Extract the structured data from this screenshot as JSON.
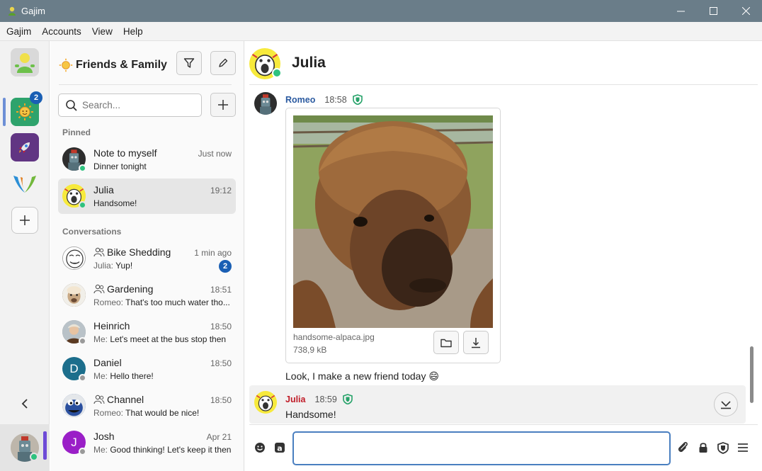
{
  "window": {
    "title": "Gajim"
  },
  "menu": [
    "Gajim",
    "Accounts",
    "View",
    "Help"
  ],
  "rail": {
    "badge": "2"
  },
  "sidebar": {
    "workspace_title": "Friends & Family",
    "search_placeholder": "Search...",
    "pinned_label": "Pinned",
    "conversations_label": "Conversations",
    "pinned": [
      {
        "name": "Note to myself",
        "time": "Just now",
        "who": "",
        "preview": "Dinner tonight",
        "group": false,
        "presence": "#2ec27e"
      },
      {
        "name": "Julia",
        "time": "19:12",
        "who": "",
        "preview": "Handsome!",
        "group": false,
        "presence": "#2ec27e"
      }
    ],
    "conversations": [
      {
        "name": "Bike Shedding",
        "time": "1 min ago",
        "who": "Julia: ",
        "preview": "Yup!",
        "group": true,
        "badge": "2"
      },
      {
        "name": "Gardening",
        "time": "18:51",
        "who": "Romeo: ",
        "preview": "That's too much water tho...",
        "group": true
      },
      {
        "name": "Heinrich",
        "time": "18:50",
        "who": "Me: ",
        "preview": "Let's meet at the bus stop then",
        "group": false,
        "presence": "#9a9a9a"
      },
      {
        "name": "Daniel",
        "time": "18:50",
        "who": "Me: ",
        "preview": "Hello there!",
        "group": false,
        "presence": "#9a9a9a",
        "initial": "D",
        "color": "#1c6e8c"
      },
      {
        "name": "Channel",
        "time": "18:50",
        "who": "Romeo: ",
        "preview": "That would be nice!",
        "group": true
      },
      {
        "name": "Josh",
        "time": "Apr 21",
        "who": "Me: ",
        "preview": "Good thinking! Let's keep it then",
        "group": false,
        "presence": "#9a9a9a",
        "initial": "J",
        "color": "#9a1fc7"
      }
    ]
  },
  "chat": {
    "contact_name": "Julia",
    "messages": [
      {
        "sender": "Romeo",
        "sender_color": "#2b5aa0",
        "time": "18:58",
        "file_name": "handsome-alpaca.jpg",
        "file_size": "738,9 kB",
        "text": "Look, I make a new friend today 😄"
      },
      {
        "sender": "Julia",
        "sender_color": "#c01c28",
        "time": "18:59",
        "text": "Handsome!"
      }
    ],
    "composer_placeholder": ""
  },
  "colors": {
    "accent": "#4a7fc0",
    "titlebar": "#6a7d89",
    "badge": "#1a5fb4",
    "online": "#2ec27e",
    "omemo": "#26a269"
  }
}
